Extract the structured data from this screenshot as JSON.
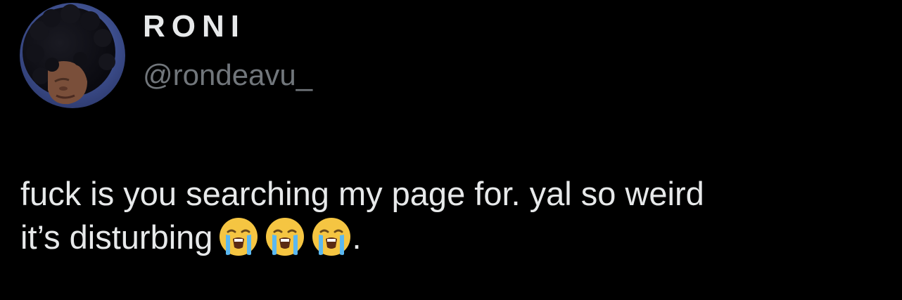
{
  "user": {
    "display_name": "RONI",
    "handle": "@rondeavu_"
  },
  "tweet": {
    "line1": "fuck is you searching my page for. yal so weird",
    "line2_text": "it’s disturbing",
    "emojis": [
      "loudly-crying-face",
      "loudly-crying-face",
      "loudly-crying-face"
    ],
    "line2_end": "."
  },
  "colors": {
    "background": "#000000",
    "primary_text": "#e7e9ea",
    "secondary_text": "#71767b"
  }
}
